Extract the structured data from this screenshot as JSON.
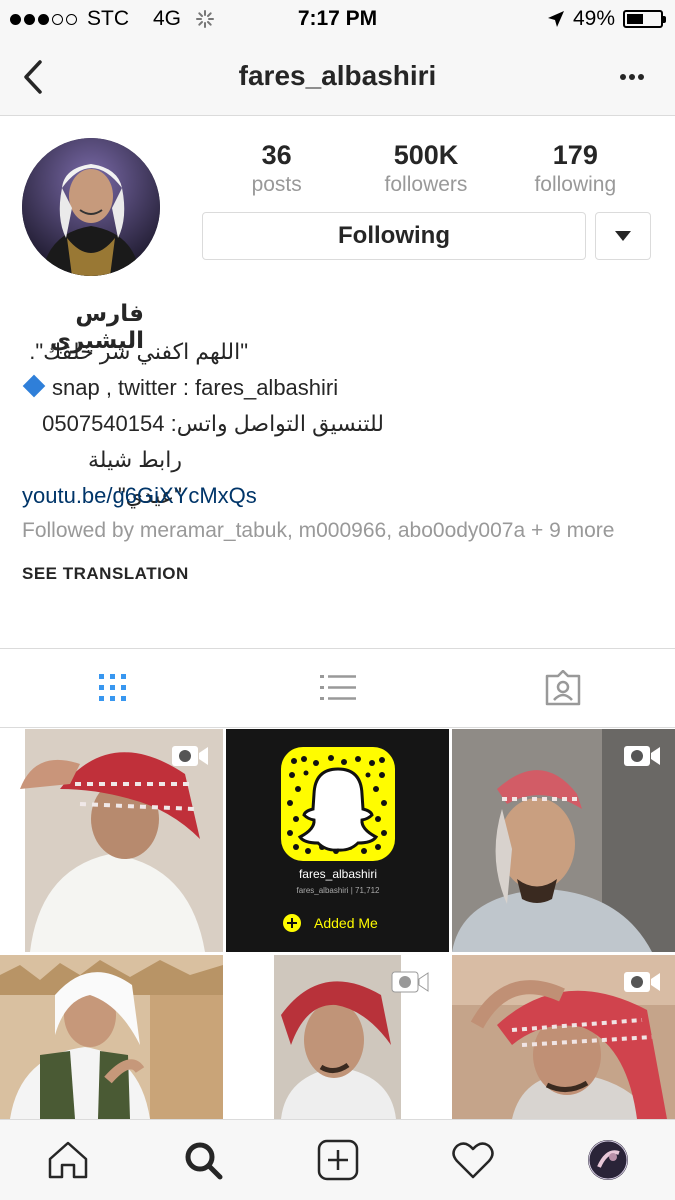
{
  "status_bar": {
    "carrier": "STC",
    "network": "4G",
    "time": "7:17 PM",
    "battery": "49%",
    "battery_level": 0.49
  },
  "nav": {
    "title": "fares_albashiri"
  },
  "stats": [
    {
      "value": "36",
      "label": "posts"
    },
    {
      "value": "500K",
      "label": "followers"
    },
    {
      "value": "179",
      "label": "following"
    }
  ],
  "follow_button": "Following",
  "bio": {
    "name": "فارس البشيري",
    "line1": "\"اللهم اكفني شر خلقك\".",
    "line2": "snap , twitter : fares_albashiri",
    "line3": "للتنسيق التواصل واتس: 0507540154",
    "line4": "رابط شيلة \"عيدي\"",
    "link": "youtu.be/g6GiXYcMxQs",
    "followed_by": "Followed by meramar_tabuk, m000966, abo0ody007a + 9 more",
    "see_translation": "SEE TRANSLATION"
  },
  "snap_tile": {
    "username": "fares_albashiri",
    "sub": "fares_albashiri | 71,712",
    "added": "Added Me"
  },
  "colors": {
    "accent": "#3897f0",
    "link": "#003569",
    "secondary_text": "#999999",
    "snap_yellow": "#fffc00"
  },
  "icons": {
    "tab_grid": "grid-icon",
    "tab_list": "list-icon",
    "tab_tagged": "tagged-icon",
    "home": "home-icon",
    "search": "search-icon",
    "add": "add-icon",
    "activity": "heart-icon",
    "profile": "profile-avatar"
  }
}
